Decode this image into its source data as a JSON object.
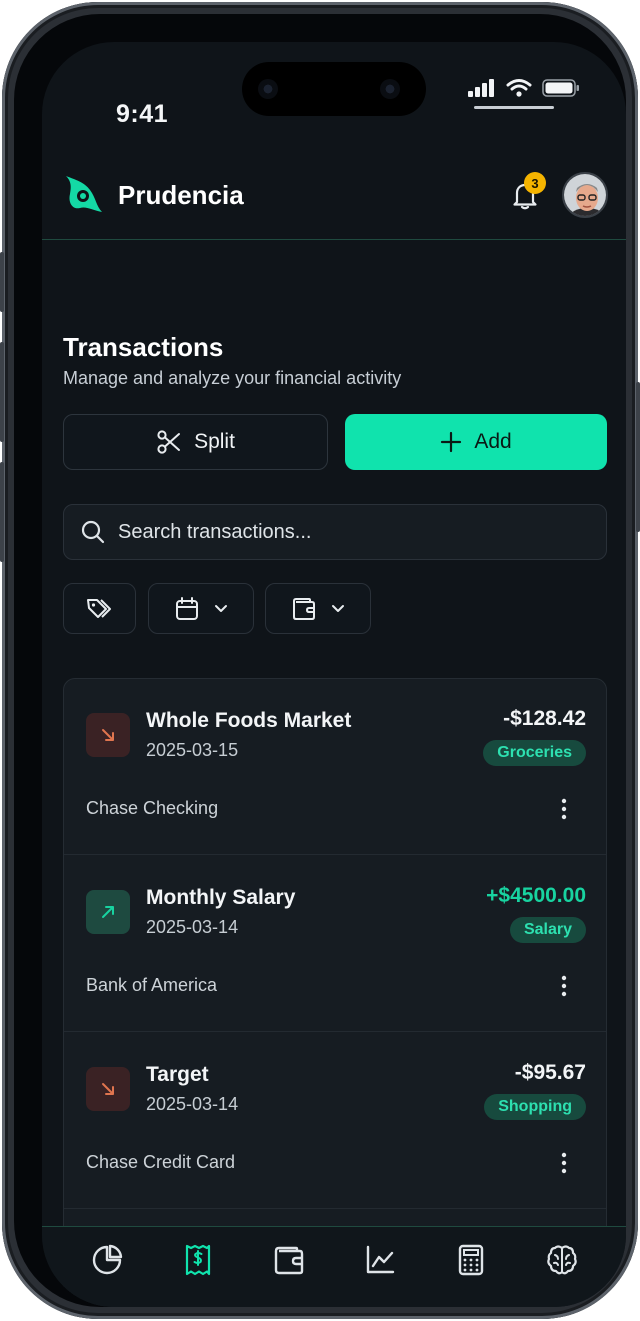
{
  "status_bar": {
    "time": "9:41"
  },
  "header": {
    "brand": "Prudencia",
    "notification_count": "3"
  },
  "page": {
    "title": "Transactions",
    "subtitle": "Manage and analyze your financial activity"
  },
  "actions": {
    "split_label": "Split",
    "add_label": "Add"
  },
  "search": {
    "placeholder": "Search transactions..."
  },
  "transactions": [
    {
      "name": "Whole Foods Market",
      "date": "2025-03-15",
      "amount": "-$128.42",
      "category": "Groceries",
      "account": "Chase Checking",
      "type": "expense"
    },
    {
      "name": "Monthly Salary",
      "date": "2025-03-14",
      "amount": "+$4500.00",
      "category": "Salary",
      "account": "Bank of America",
      "type": "income"
    },
    {
      "name": "Target",
      "date": "2025-03-14",
      "amount": "-$95.67",
      "category": "Shopping",
      "account": "Chase Credit Card",
      "type": "expense"
    }
  ],
  "nav": [
    "pie-chart-icon",
    "receipt-icon",
    "wallet-icon",
    "line-chart-icon",
    "calculator-icon",
    "brain-icon"
  ],
  "colors": {
    "accent": "#10e3ad",
    "background": "#0f1419",
    "card": "#161c22",
    "income": "#18d3a0",
    "expense_arrow": "#e0754f",
    "badge": "#f5b400"
  }
}
